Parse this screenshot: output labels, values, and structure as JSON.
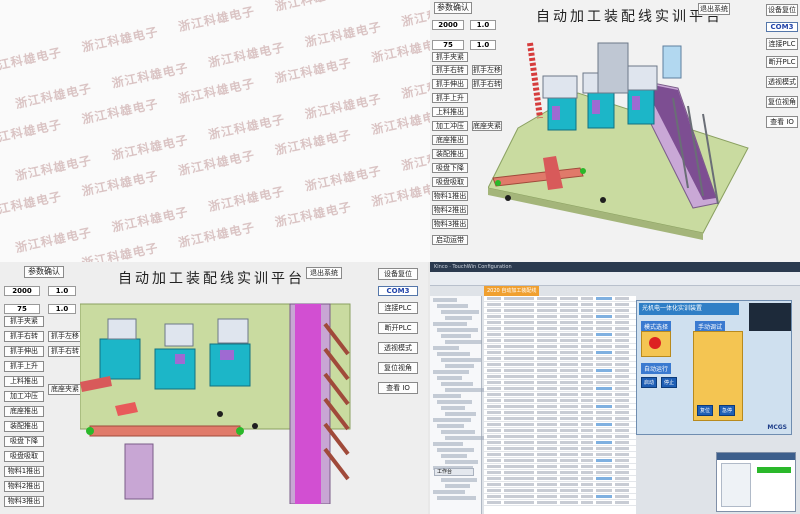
{
  "watermark": {
    "text": "浙江科雄电子"
  },
  "sim_panel": {
    "title": "自动加工装配线实训平台",
    "confirm_button": "参数确认",
    "exit_button": "退出系统",
    "param1_value": "2000",
    "param1_rate": "1.0",
    "param2_value": "75",
    "param2_rate": "1.0",
    "left_buttons": [
      "抓手夹紧",
      "抓手右转",
      "抓手伸出",
      "抓手上升",
      "上料推出",
      "加工冲压",
      "底座推出",
      "装配推出",
      "吸盘下降",
      "吸盘吸取",
      "物料1推出",
      "物料2推出",
      "物料3推出",
      "启动运带"
    ],
    "mid_buttons": [
      "抓手左移",
      "抓手右转",
      "底座夹紧"
    ],
    "right_buttons": {
      "device_reset": "设备复位",
      "port": "COM3",
      "connect_plc": "连接PLC",
      "disconnect_plc": "断开PLC",
      "transparent_mode": "透视模式",
      "reset_view": "复位视角",
      "view_io": "查看 IO"
    }
  },
  "ide": {
    "title_bar": "Kinco · TouchWin Configuration",
    "tab_label": "2020 自动加工装配线",
    "hmi_title": "光机电一体化实训装置",
    "hmi_labels": {
      "manual": "手动调试",
      "auto": "自动运行",
      "status": "模式选择"
    },
    "hmi_buttons": [
      "启动",
      "停止",
      "复位",
      "急停"
    ],
    "brand": "MCGS",
    "bottom_tab": "工作台"
  },
  "colors": {
    "accent_blue": "#2f7fc6",
    "hmi_bg": "#cfe0ef",
    "conveyor_magenta": "#d24fd2",
    "ide_orange": "#f0a030"
  }
}
